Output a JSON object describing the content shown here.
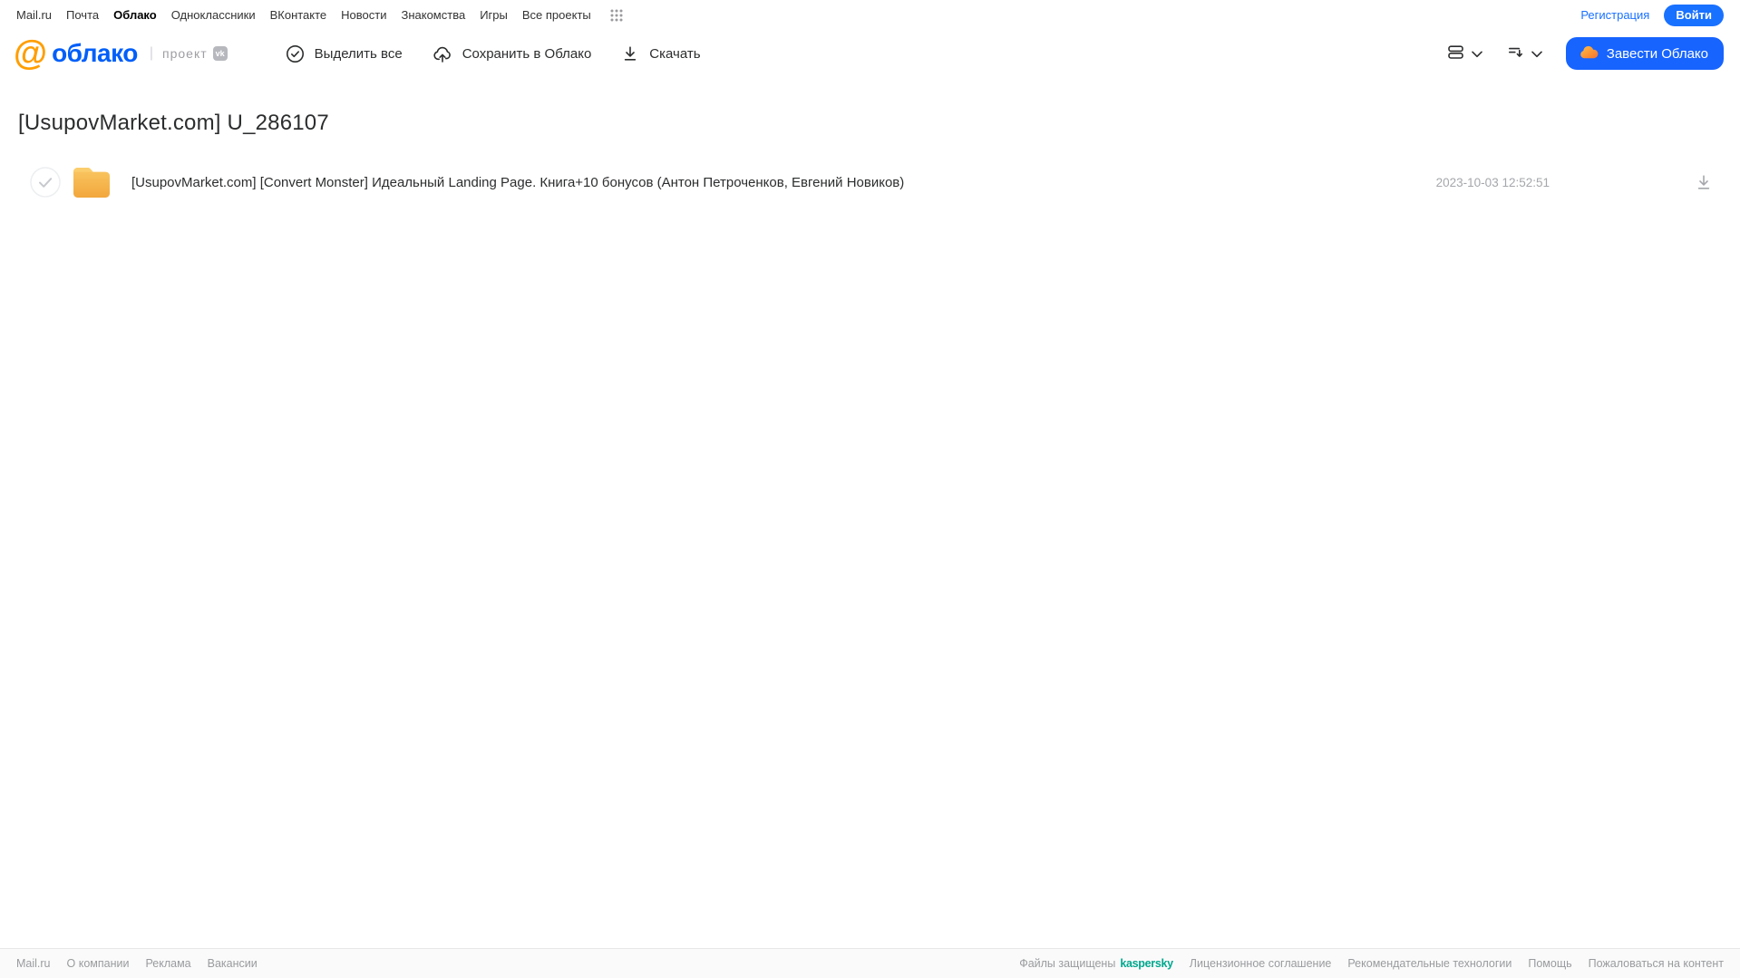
{
  "portal_bar": {
    "links": [
      "Mail.ru",
      "Почта",
      "Облако",
      "Одноклассники",
      "ВКонтакте",
      "Новости",
      "Знакомства",
      "Игры",
      "Все проекты"
    ],
    "registration_label": "Регистрация",
    "login_label": "Войти"
  },
  "header": {
    "logo_at": "@",
    "logo_text": "облако",
    "divider": "|",
    "project_label": "проект",
    "vk_badge": "vk",
    "toolbar": {
      "select_all_label": "Выделить все",
      "save_to_cloud_label": "Сохранить в Облако",
      "download_label": "Скачать"
    },
    "get_cloud_button_label": "Завести Облако"
  },
  "content": {
    "title": "[UsupovMarket.com] U_286107",
    "files": [
      {
        "name": "[UsupovMarket.com] [Convert Monster] Идеальный Landing Page. Книга+10 бонусов (Антон Петроченков, Евгений Новиков)",
        "modified": "2023-10-03 12:52:51",
        "type": "folder"
      }
    ]
  },
  "footer": {
    "left_links": [
      "Mail.ru",
      "О компании",
      "Реклама",
      "Вакансии"
    ],
    "protected_label": "Файлы защищены",
    "kaspersky_label": "kaspersky",
    "right_links": [
      "Лицензионное соглашение",
      "Рекомендательные технологии",
      "Помощь",
      "Пожаловаться на контент"
    ]
  },
  "colors": {
    "accent_blue": "#1971ff",
    "button_blue": "#1764ff",
    "logo_orange": "#ff9e00",
    "logo_blue": "#005ff9",
    "folder_yellow": "#f5b23c",
    "kaspersky_teal": "#00a88e",
    "muted_gray": "#999b9e"
  }
}
